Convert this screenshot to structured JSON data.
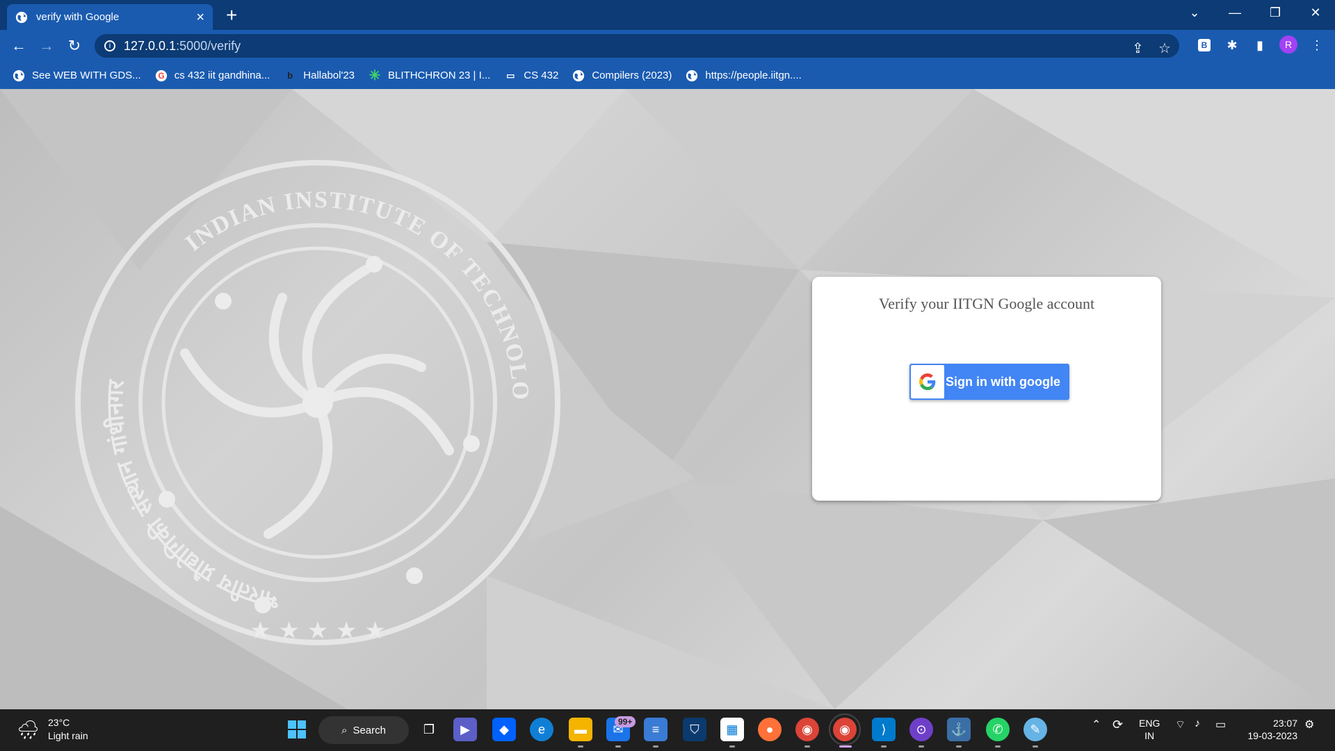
{
  "browser": {
    "tab_title": "verify with Google",
    "url_host": "127.0.0.1",
    "url_path": ":5000/verify",
    "profile_initial": "R",
    "extension_badge": "B",
    "bookmarks": [
      {
        "label": "See WEB WITH GDS...",
        "icon": "globe-icon"
      },
      {
        "label": "cs 432 iit gandhina...",
        "icon": "google-icon"
      },
      {
        "label": "Hallabol'23",
        "icon": "b-logo-icon"
      },
      {
        "label": "BLITHCHRON 23 | I...",
        "icon": "asterisk-icon"
      },
      {
        "label": "CS 432",
        "icon": "classroom-icon"
      },
      {
        "label": "Compilers (2023)",
        "icon": "globe-icon"
      },
      {
        "label": "https://people.iitgn....",
        "icon": "globe-icon"
      }
    ]
  },
  "seal": {
    "outer_text": "INDIAN INSTITUTE OF TECHNOLOGY GANDHINAGAR",
    "hindi_text": "भारतीय प्रौद्योगिकी संस्थान गांधीनगर",
    "stars": "★ ★ ★ ★ ★"
  },
  "card": {
    "title": "Verify your IITGN Google account",
    "button_label": "Sign in with google"
  },
  "taskbar": {
    "temperature": "23°C",
    "weather": "Light rain",
    "search_label": "Search",
    "mail_badge": "99+",
    "language": "ENG",
    "region": "IN",
    "time": "23:07",
    "date": "19-03-2023"
  },
  "colors": {
    "titlebar": "#0c3b75",
    "toolbar": "#1a5bb0",
    "google_blue": "#4285f4",
    "taskbar": "#1f1f1f"
  }
}
